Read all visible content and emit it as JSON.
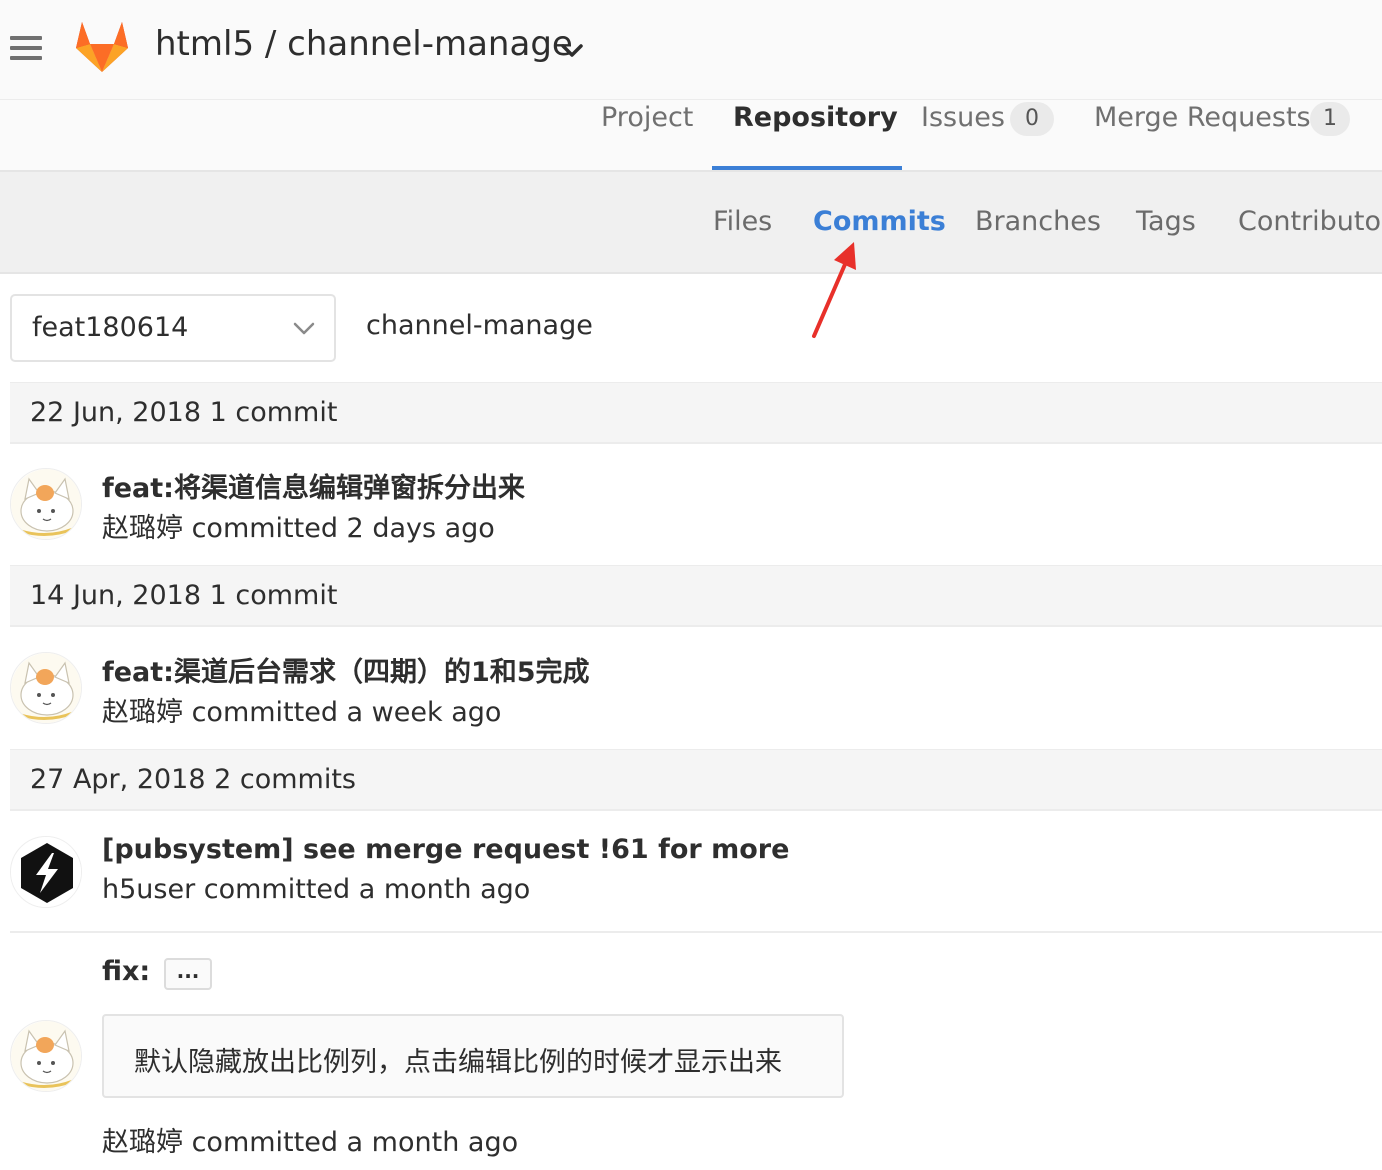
{
  "header": {
    "group": "html5",
    "separator": "/",
    "project": "channel-manage"
  },
  "primary_nav": {
    "items": [
      {
        "label": "Project"
      },
      {
        "label": "Repository"
      },
      {
        "label": "Issues",
        "count": "0"
      },
      {
        "label": "Merge Requests",
        "count": "1"
      }
    ],
    "active": "Repository"
  },
  "sub_nav": {
    "items": [
      {
        "label": "Files"
      },
      {
        "label": "Commits"
      },
      {
        "label": "Branches"
      },
      {
        "label": "Tags"
      },
      {
        "label": "Contributor"
      }
    ],
    "active": "Commits"
  },
  "branch_selector": {
    "value": "feat180614"
  },
  "breadcrumb": {
    "path": "channel-manage"
  },
  "days": [
    {
      "header": "22 Jun, 2018 1 commit",
      "commits": [
        {
          "title": "feat:将渠道信息编辑弹窗拆分出来",
          "meta": "赵璐婷 committed 2 days ago"
        }
      ]
    },
    {
      "header": "14 Jun, 2018 1 commit",
      "commits": [
        {
          "title": "feat:渠道后台需求（四期）的1和5完成",
          "meta": "赵璐婷 committed a week ago"
        }
      ]
    },
    {
      "header": "27 Apr, 2018 2 commits",
      "commits": [
        {
          "title": "[pubsystem] see merge request !61 for more",
          "meta": "h5user committed a month ago"
        },
        {
          "title": "fix:",
          "toggle": "...",
          "description": "默认隐藏放出比例列，点击编辑比例的时候才显示出来",
          "meta": "赵璐婷 committed a month ago"
        }
      ]
    }
  ],
  "colors": {
    "accent": "#3b7fd6",
    "header_bg": "#fafafa",
    "subnav_bg": "#f0f0f0",
    "annotation_arrow": "#e8302a"
  },
  "icons": [
    "menu-icon",
    "gitlab-logo",
    "chevron-down-icon",
    "annotation-arrow"
  ]
}
